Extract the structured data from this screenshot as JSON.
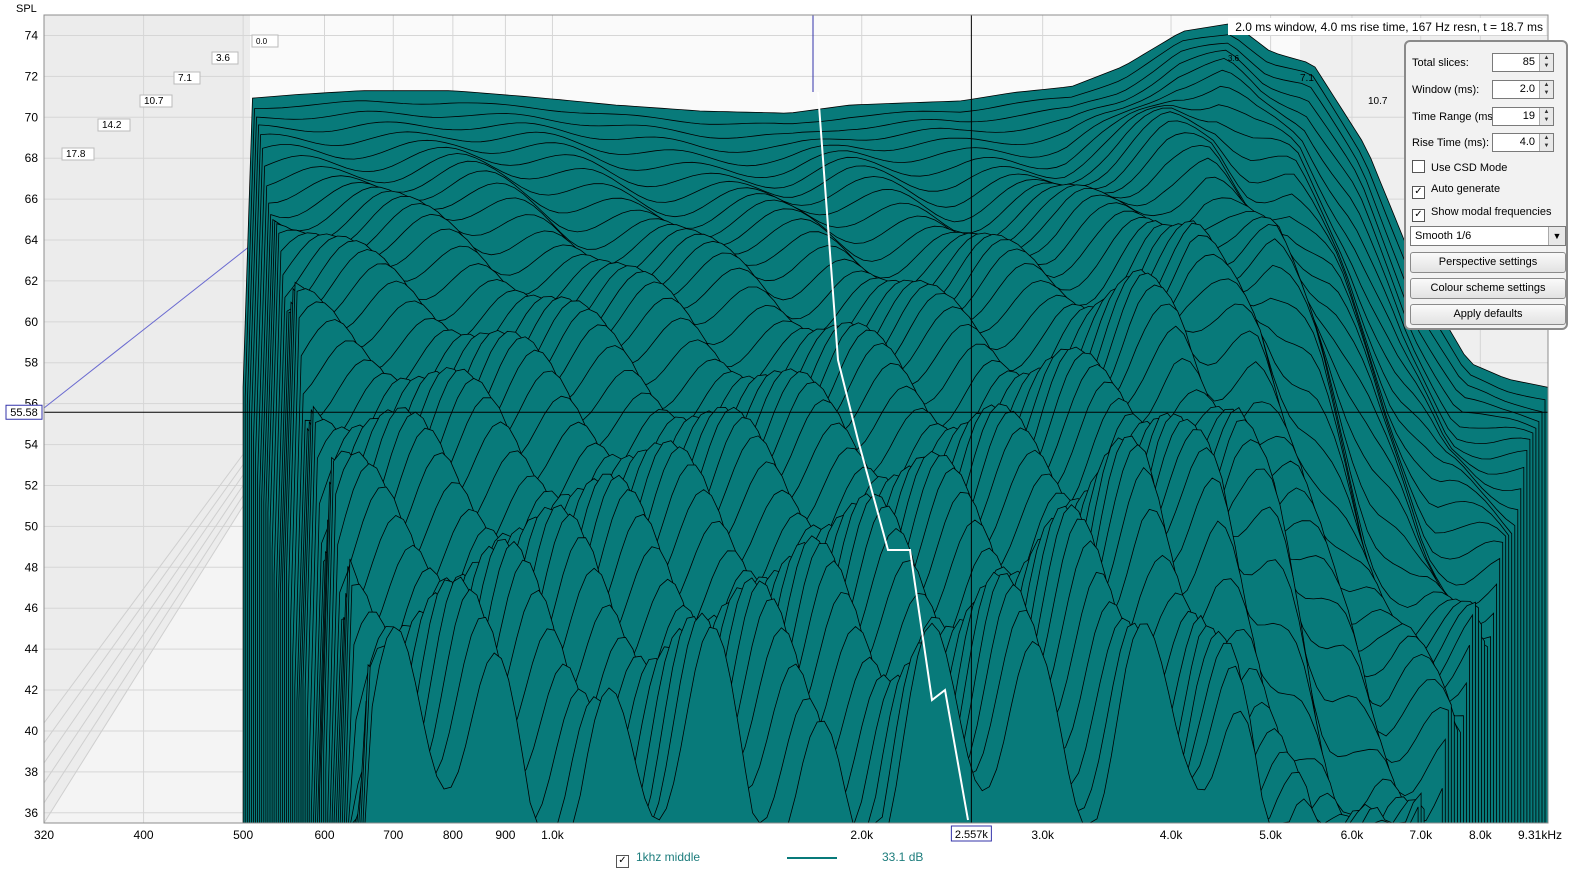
{
  "chart_data": {
    "type": "area",
    "style": "cumulative spectral decay waterfall",
    "ylabel": "SPL",
    "xunit": "kHz",
    "header": "2.0 ms window, 4.0 ms rise time,  167 Hz resn, t = 18.7 ms",
    "ylim": [
      35.5,
      75
    ],
    "yticks": [
      74,
      72,
      70,
      68,
      66,
      64,
      62,
      60,
      58,
      56,
      54,
      52,
      50,
      48,
      46,
      44,
      42,
      40,
      38,
      36
    ],
    "xlim_hz": [
      320,
      9310
    ],
    "x_scale": "log",
    "xticks": [
      {
        "hz": 320,
        "label": "320"
      },
      {
        "hz": 400,
        "label": "400"
      },
      {
        "hz": 500,
        "label": "500"
      },
      {
        "hz": 600,
        "label": "600"
      },
      {
        "hz": 700,
        "label": "700"
      },
      {
        "hz": 800,
        "label": "800"
      },
      {
        "hz": 900,
        "label": "900"
      },
      {
        "hz": 1000,
        "label": "1.0k"
      },
      {
        "hz": 2000,
        "label": "2.0k"
      },
      {
        "hz": 3000,
        "label": "3.0k"
      },
      {
        "hz": 4000,
        "label": "4.0k"
      },
      {
        "hz": 5000,
        "label": "5.0k"
      },
      {
        "hz": 6000,
        "label": "6.0k"
      },
      {
        "hz": 7000,
        "label": "7.0k"
      },
      {
        "hz": 8000,
        "label": "8.0k"
      },
      {
        "hz": 9310,
        "label": "9.31kHz"
      }
    ],
    "time_labels_ms": [
      "0.0",
      "3.6",
      "7.1",
      "10.7",
      "14.2",
      "17.8"
    ],
    "cursor": {
      "freq_hz": 2557,
      "freq_label": "2.557k",
      "spl": 55.58,
      "spl_label": "55.58"
    },
    "slices": 85,
    "fill_color": "#087a7a",
    "line_color": "#000000",
    "modal_line_color": "#ffffff",
    "envelope_front": {
      "hz": [
        500,
        560,
        650,
        800,
        950,
        1150,
        1400,
        1700,
        1950,
        2200,
        2500,
        2800,
        3200,
        3600,
        4100,
        4600,
        5000,
        5500,
        6200,
        7000,
        7800,
        8500,
        9310
      ],
      "spl": [
        70.9,
        71.1,
        71.3,
        71.3,
        71.0,
        70.6,
        70.3,
        70.2,
        70.6,
        70.7,
        70.8,
        71.2,
        71.5,
        72.5,
        74.2,
        74.6,
        73.2,
        72.6,
        68.5,
        62.0,
        58.0,
        57.2,
        56.8
      ]
    }
  },
  "legend": {
    "series_name": "1khz middle",
    "value": "33.1 dB",
    "checked": true,
    "line_color": "#087a7a"
  },
  "panel": {
    "total_slices_label": "Total slices:",
    "total_slices": "85",
    "window_label": "Window (ms):",
    "window": "2.0",
    "time_range_label": "Time Range (ms):",
    "time_range": "19",
    "rise_time_label": "Rise Time (ms):",
    "rise_time": "4.0",
    "csd_mode_label": "Use CSD Mode",
    "csd_mode": false,
    "auto_generate_label": "Auto generate",
    "auto_generate": true,
    "show_modal_label": "Show modal frequencies",
    "show_modal": true,
    "smoothing": "Smooth 1/6",
    "perspective_button": "Perspective settings",
    "colour_button": "Colour scheme settings",
    "defaults_button": "Apply defaults"
  }
}
